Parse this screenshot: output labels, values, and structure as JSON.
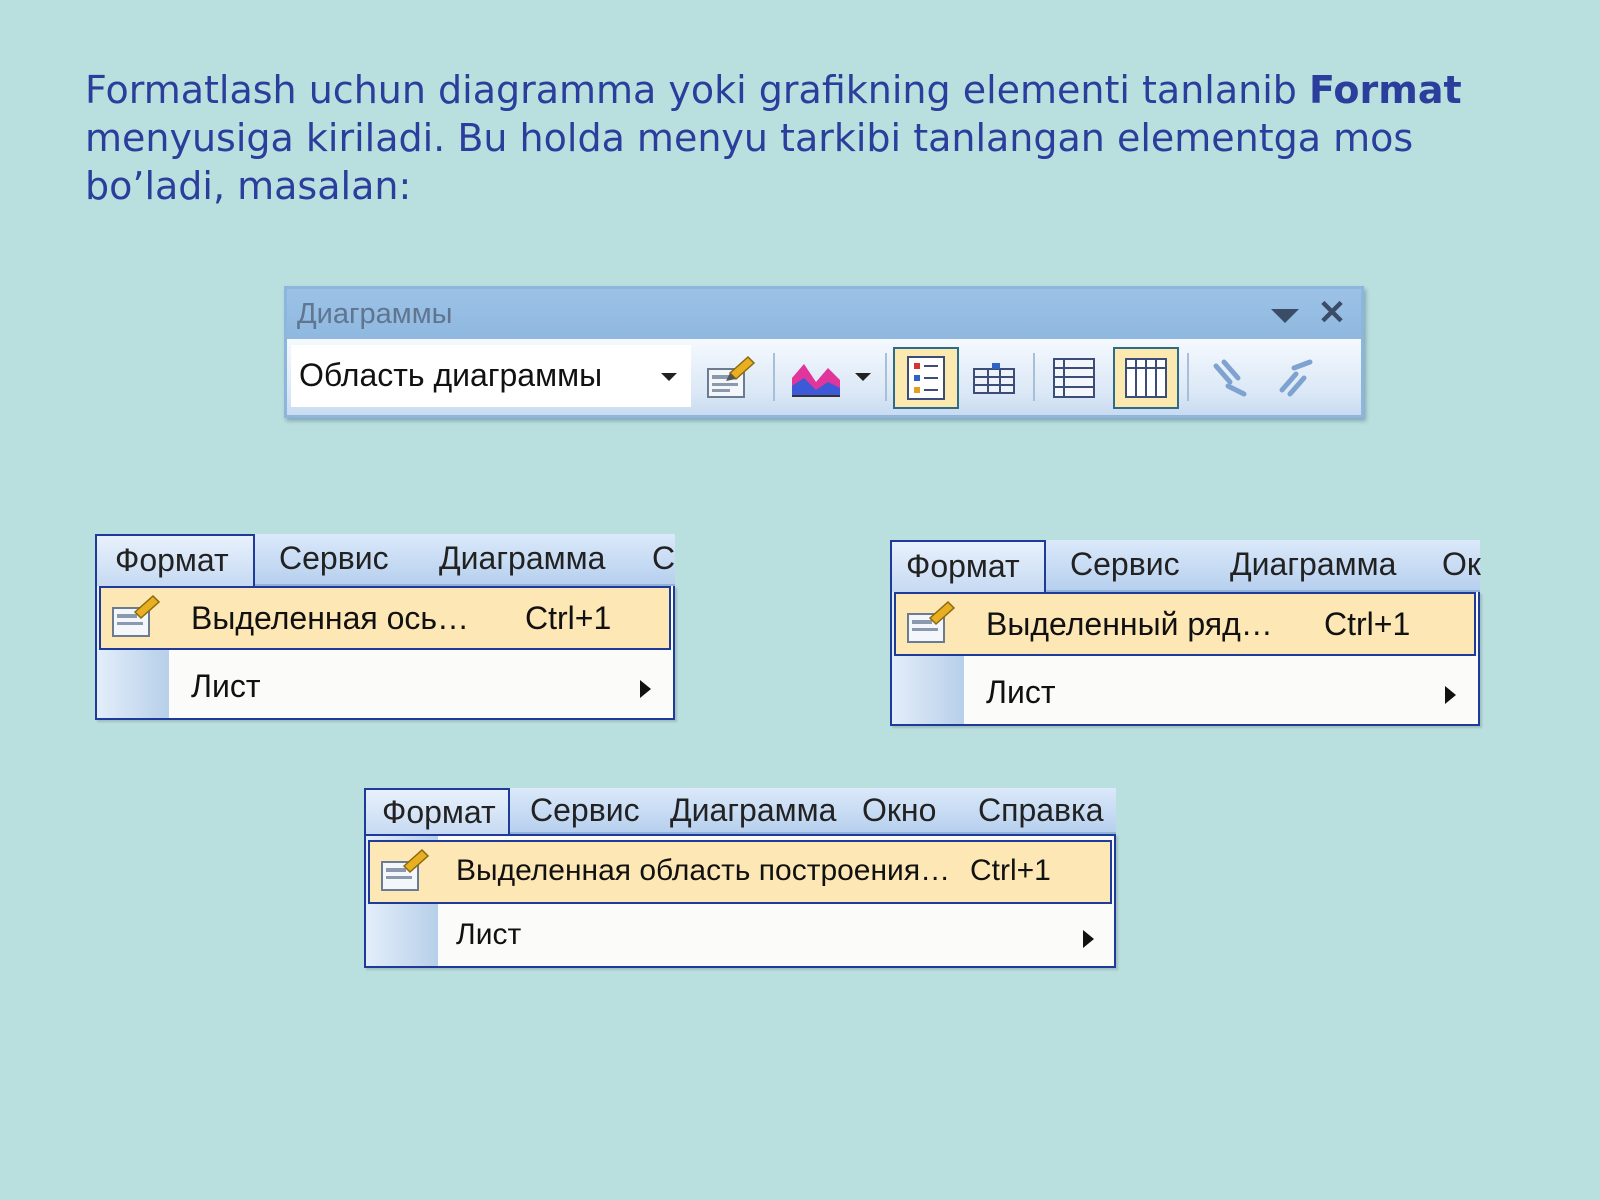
{
  "intro": {
    "line1_before": "Formatlash uchun diagramma yoki grafikning elementi tanlanib ",
    "line1_bold": "Format",
    "line2": "menyusiga kiriladi. Bu holda menyu tarkibi tanlangan elementga mos bo’ladi, masalan:"
  },
  "toolbar": {
    "title": "Диаграммы",
    "close_glyph": "✕",
    "select_value": "Область диаграммы",
    "buttons": [
      "format-chart-area",
      "chart-type",
      "legend",
      "data-table",
      "by-row",
      "by-column",
      "angle-text-down",
      "angle-text-up"
    ]
  },
  "menu1": {
    "bar": [
      "Формат",
      "Сервис",
      "Диаграмма",
      "С"
    ],
    "item1": "Выделенная ось…",
    "item1_shortcut": "Ctrl+1",
    "item2": "Лист"
  },
  "menu2": {
    "bar": [
      "Формат",
      "Сервис",
      "Диаграмма",
      "Ок"
    ],
    "item1": "Выделенный ряд…",
    "item1_shortcut": "Ctrl+1",
    "item2": "Лист"
  },
  "menu3": {
    "bar": [
      "Формат",
      "Сервис",
      "Диаграмма",
      "Окно",
      "Справка"
    ],
    "item1": "Выделенная область построения…",
    "item1_shortcut": "Ctrl+1",
    "item2": "Лист"
  },
  "colors": {
    "background": "#b9e0df",
    "text_accent": "#2c3e9c",
    "highlight": "#fde7b4",
    "menu_border": "#1e3a9a"
  }
}
